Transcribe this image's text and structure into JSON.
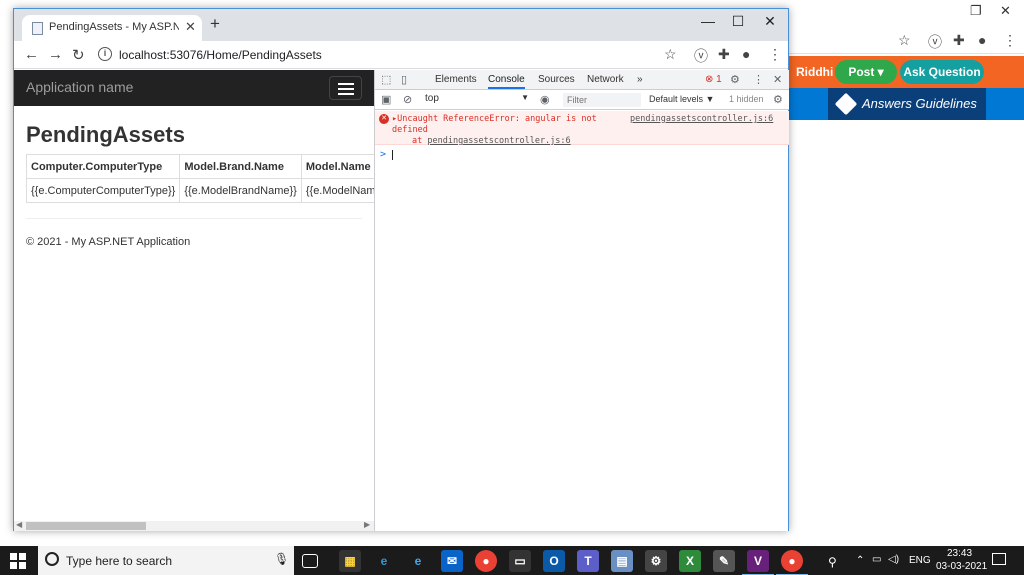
{
  "background_window": {
    "user_name": "Riddhi",
    "post_label": "Post ▾",
    "ask_label": "Ask Question",
    "guidelines_label": "Answers Guidelines"
  },
  "browser": {
    "tab_title": "PendingAssets - My ASP.NET App",
    "url": "localhost:53076/Home/PendingAssets"
  },
  "page": {
    "brand": "Application name",
    "heading": "PendingAssets",
    "table": {
      "headers": [
        "Computer.ComputerType",
        "Model.Brand.Name",
        "Model.Name"
      ],
      "rows": [
        [
          "{{e.ComputerComputerType}}",
          "{{e.ModelBrandName}}",
          "{{e.ModelName'}}"
        ]
      ]
    },
    "footer": "© 2021 - My ASP.NET Application"
  },
  "devtools": {
    "tabs": [
      "Elements",
      "Console",
      "Sources",
      "Network"
    ],
    "active_tab": "Console",
    "more_tabs": "»",
    "error_count": "1",
    "context": "top",
    "filter_placeholder": "Filter",
    "levels": "Default levels ▼",
    "hidden": "1 hidden",
    "error": {
      "line1": "▸Uncaught ReferenceError: angular is not",
      "line2": "defined",
      "line3_prefix": "at ",
      "line3_source": "pendingassetscontroller.js:6",
      "source_link": "pendingassetscontroller.js:6"
    },
    "prompt": ">"
  },
  "taskbar": {
    "search_placeholder": "Type here to search",
    "language": "ENG",
    "time": "23:43",
    "date": "03-03-2021"
  }
}
